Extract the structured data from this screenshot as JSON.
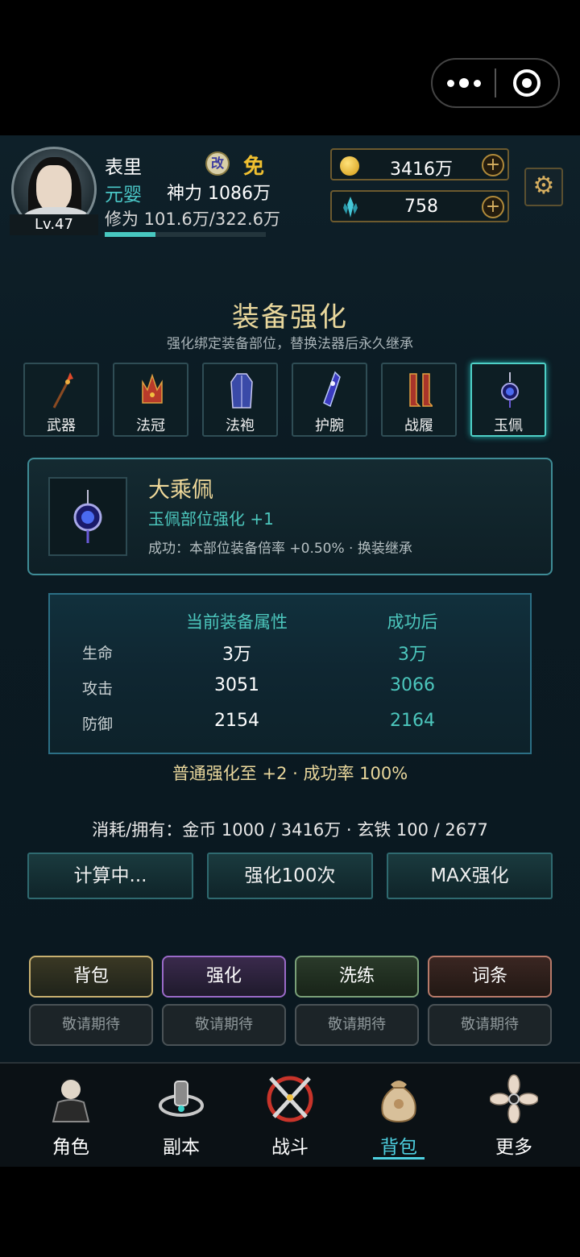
{
  "player": {
    "name": "表里",
    "realm": "元婴",
    "power": "神力 1086万",
    "level": "Lv.47",
    "gai_badge": "改",
    "mian_badge": "免",
    "cultivation": "修为 101.6万/322.6万",
    "cultivation_progress": 0.315
  },
  "resources": {
    "gold": "3416万",
    "crystal": "758"
  },
  "page": {
    "title": "装备强化",
    "subtitle": "强化绑定装备部位，替换法器后永久继承"
  },
  "slots": [
    {
      "label": "武器",
      "icon": "spear-icon"
    },
    {
      "label": "法冠",
      "icon": "crown-icon"
    },
    {
      "label": "法袍",
      "icon": "robe-icon"
    },
    {
      "label": "护腕",
      "icon": "bracer-icon"
    },
    {
      "label": "战履",
      "icon": "boots-icon"
    },
    {
      "label": "玉佩",
      "icon": "pendant-icon"
    }
  ],
  "selected_slot": 5,
  "item": {
    "name": "大乘佩",
    "upgrade": "玉佩部位强化 +1",
    "effect": "成功：本部位装备倍率 +0.50% · 换装继承"
  },
  "stats": {
    "header_current": "当前装备属性",
    "header_after": "成功后",
    "rows": [
      {
        "key": "生命",
        "current": "3万",
        "after": "3万"
      },
      {
        "key": "攻击",
        "current": "3051",
        "after": "3066"
      },
      {
        "key": "防御",
        "current": "2154",
        "after": "2164"
      }
    ]
  },
  "rate_text": "普通强化至 +2 · 成功率 100%",
  "cost_text": "消耗/拥有：金币 1000 / 3416万 · 玄铁 100 / 2677",
  "actions": {
    "calc": "计算中...",
    "x100": "强化100次",
    "max": "MAX强化"
  },
  "menu": {
    "main": [
      "背包",
      "强化",
      "洗练",
      "词条"
    ],
    "soon": [
      "敬请期待",
      "敬请期待",
      "敬请期待",
      "敬请期待"
    ]
  },
  "tabs": [
    {
      "label": "角色",
      "icon": "character-icon"
    },
    {
      "label": "副本",
      "icon": "dungeon-icon"
    },
    {
      "label": "战斗",
      "icon": "battle-icon"
    },
    {
      "label": "背包",
      "icon": "bag-icon",
      "active": true
    },
    {
      "label": "更多",
      "icon": "more-icon"
    }
  ],
  "colors": {
    "accent": "#4ed0c6",
    "gold": "#e9d79c",
    "tab_active": "#4ed0e0"
  }
}
